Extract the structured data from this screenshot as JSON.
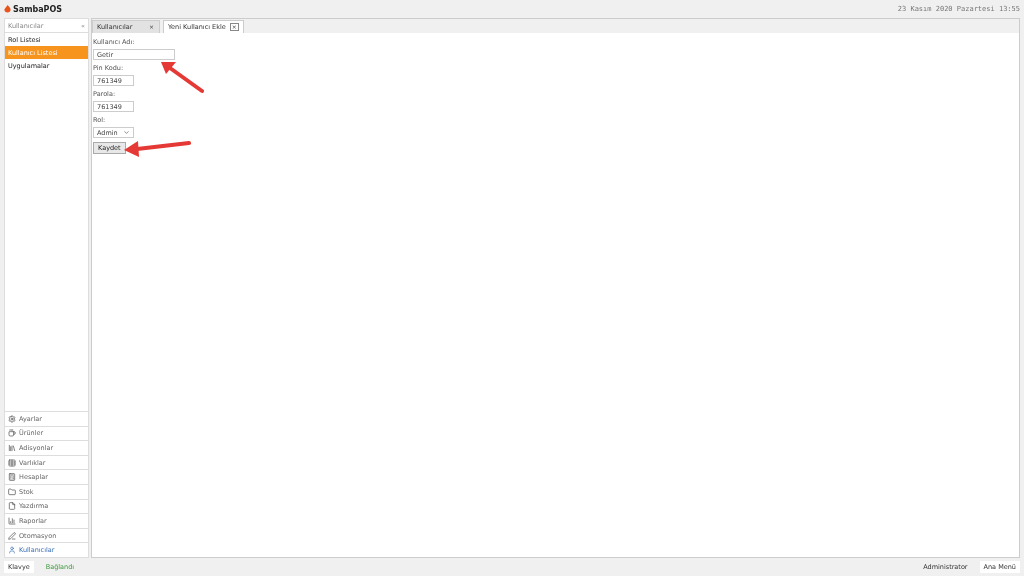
{
  "app": {
    "logo": "SambaPOS",
    "datetime": "23 Kasım 2020 Pazartesi 13:55"
  },
  "sidebar": {
    "header": {
      "label": "Kullanıcılar",
      "collapse": "«"
    },
    "items": [
      {
        "label": "Rol Listesi",
        "selected": false
      },
      {
        "label": "Kullanıcı Listesi",
        "selected": true
      },
      {
        "label": "Uygulamalar",
        "selected": false
      }
    ],
    "nav": [
      {
        "label": "Ayarlar",
        "selected": false
      },
      {
        "label": "Ürünler",
        "selected": false
      },
      {
        "label": "Adisyonlar",
        "selected": false
      },
      {
        "label": "Varlıklar",
        "selected": false
      },
      {
        "label": "Hesaplar",
        "selected": false
      },
      {
        "label": "Stok",
        "selected": false
      },
      {
        "label": "Yazdırma",
        "selected": false
      },
      {
        "label": "Raporlar",
        "selected": false
      },
      {
        "label": "Otomasyon",
        "selected": false
      },
      {
        "label": "Kullanıcılar",
        "selected": true
      }
    ]
  },
  "tabs": [
    {
      "label": "Kullanıcılar",
      "close": "×",
      "selected": false
    },
    {
      "label": "Yeni Kullanıcı Ekle",
      "close": "×",
      "selected": true
    }
  ],
  "form": {
    "fields": [
      {
        "kind": "text",
        "label": "Kullanıcı Adı:",
        "value": "Getir"
      },
      {
        "kind": "text",
        "label": "Pin Kodu:",
        "value": "761349"
      },
      {
        "kind": "text",
        "label": "Parola:",
        "value": "761349"
      },
      {
        "kind": "select",
        "label": "Rol:",
        "value": "Admin"
      }
    ],
    "button": "Kaydet"
  },
  "status_bar": {
    "keyboard": "Klavye",
    "connection": "Bağlandı",
    "user": "Administrator",
    "menu": "Ana Menü"
  }
}
